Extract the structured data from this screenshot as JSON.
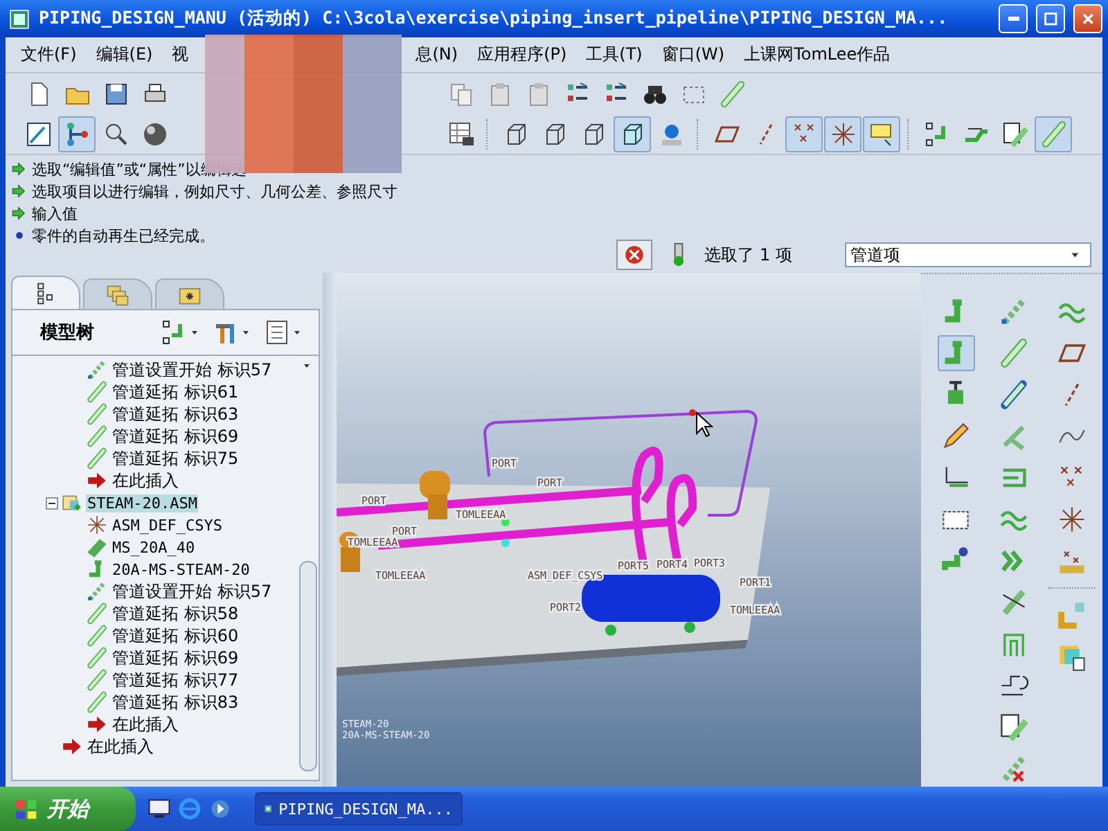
{
  "window": {
    "title": "PIPING_DESIGN_MANU (活动的) C:\\3cola\\exercise\\piping_insert_pipeline\\PIPING_DESIGN_MA..."
  },
  "menu": [
    {
      "label": "文件(F)"
    },
    {
      "label": "编辑(E)"
    },
    {
      "label": "视"
    },
    {
      "label": "息(N)"
    },
    {
      "label": "应用程序(P)"
    },
    {
      "label": "工具(T)"
    },
    {
      "label": "窗口(W)"
    },
    {
      "label": "上课网TomLee作品"
    }
  ],
  "toolbar_1": [
    {
      "pressed": false
    },
    {
      "pressed": false
    },
    {
      "pressed": false
    },
    {
      "pressed": false
    },
    {
      "pressed": false
    },
    {
      "pressed": false
    },
    {
      "pressed": false
    },
    {
      "pressed": false
    },
    {
      "pressed": false
    },
    {
      "pressed": false
    },
    {
      "pressed": false
    },
    {
      "pressed": false
    }
  ],
  "toolbar_2": [
    {
      "pressed": false
    },
    {
      "pressed": true
    },
    {
      "pressed": false
    },
    {
      "pressed": false
    },
    {
      "pressed": false
    },
    {
      "pressed": false
    },
    {
      "pressed": false
    },
    {
      "pressed": false
    },
    {
      "pressed": true
    },
    {
      "pressed": false
    },
    {
      "pressed": false
    },
    {
      "pressed": false
    },
    {
      "pressed": true
    },
    {
      "pressed": true
    },
    {
      "pressed": true
    },
    {
      "pressed": false
    },
    {
      "pressed": false
    },
    {
      "pressed": false
    },
    {
      "pressed": true
    }
  ],
  "messages": [
    {
      "kind": "prompt",
      "text": "选取“编辑值”或“属性”以编辑选"
    },
    {
      "kind": "prompt",
      "text": "选取项目以进行编辑，例如尺寸、几何公差、参照尺寸"
    },
    {
      "kind": "prompt",
      "text": "输入值"
    },
    {
      "kind": "info",
      "text": "零件的自动再生已经完成。"
    }
  ],
  "status": {
    "selection": "选取了 1 项",
    "filter": "管道项"
  },
  "panel_tabs": [
    {
      "selected": true
    },
    {
      "selected": false
    },
    {
      "selected": false
    }
  ],
  "model_tree": {
    "title": "模型树",
    "items": [
      {
        "kind": "group",
        "children": [
          {
            "kind": "start",
            "label": "管道设置开始 标识57"
          },
          {
            "kind": "extend",
            "label": "管道延拓 标识61"
          },
          {
            "kind": "extend",
            "label": "管道延拓 标识63"
          },
          {
            "kind": "extend",
            "label": "管道延拓 标识69"
          },
          {
            "kind": "extend",
            "label": "管道延拓 标识75"
          },
          {
            "kind": "insert",
            "label": "在此插入"
          }
        ]
      },
      {
        "kind": "assembly",
        "label": "STEAM-20.ASM",
        "expanded": true,
        "selected": true,
        "children": [
          {
            "kind": "csys",
            "label": "ASM_DEF_CSYS"
          },
          {
            "kind": "spec",
            "label": "MS_20A_40"
          },
          {
            "kind": "line",
            "label": "20A-MS-STEAM-20"
          },
          {
            "kind": "start",
            "label": "管道设置开始 标识57"
          },
          {
            "kind": "extend",
            "label": "管道延拓 标识58"
          },
          {
            "kind": "extend",
            "label": "管道延拓 标识60"
          },
          {
            "kind": "extend",
            "label": "管道延拓 标识69"
          },
          {
            "kind": "extend",
            "label": "管道延拓 标识77"
          },
          {
            "kind": "extend",
            "label": "管道延拓 标识83"
          },
          {
            "kind": "insert",
            "label": "在此插入"
          }
        ]
      },
      {
        "kind": "insert",
        "label": "在此插入"
      }
    ]
  },
  "viewport": {
    "labels": [
      "PORT",
      "PORT",
      "PORT",
      "PORT",
      "TOMLEEAA",
      "TOMLEEAA",
      "TOMLEEAA",
      "ASM_DEF_CSYS",
      "PORT5",
      "PORT4",
      "PORT3",
      "PORT2",
      "TOMLEEAA",
      "PORT1"
    ],
    "info": [
      "STEAM-20",
      "20A-MS-STEAM-20"
    ]
  },
  "palette": [
    {
      "pressed": false
    },
    {
      "pressed": true
    },
    {
      "pressed": false
    },
    {
      "pressed": false
    },
    {
      "pressed": false
    },
    {
      "pressed": false
    },
    {
      "pressed": false
    }
  ],
  "taskbar": {
    "start": "开始",
    "task": "PIPING_DESIGN_MA..."
  }
}
